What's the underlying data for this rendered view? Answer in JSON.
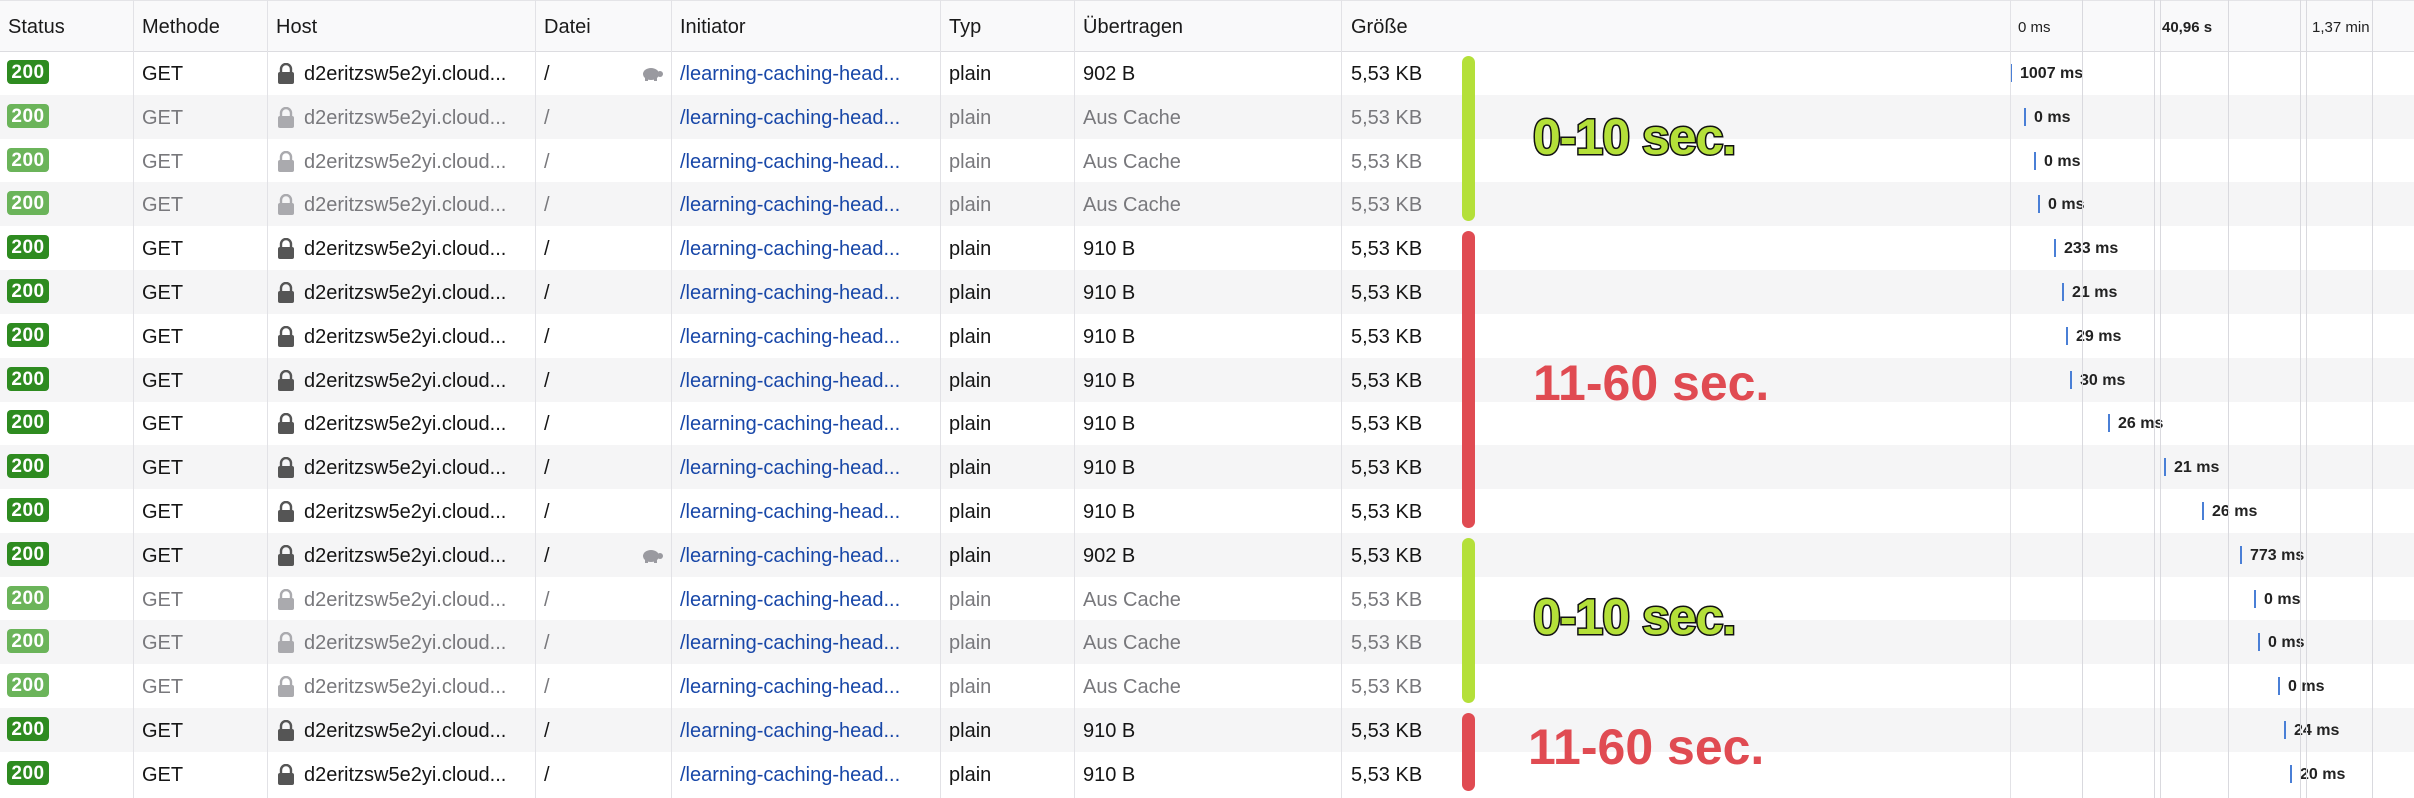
{
  "columns": {
    "status": "Status",
    "method": "Methode",
    "host": "Host",
    "file": "Datei",
    "initiator": "Initiator",
    "type": "Typ",
    "transferred": "Übertragen",
    "size": "Größe"
  },
  "timeline_ticks": [
    "0 ms",
    "40,96 s",
    "1,37 min"
  ],
  "rows": [
    {
      "status": "200",
      "method": "GET",
      "host": "d2eritzsw5e2yi.cloud...",
      "file": "/",
      "initiator": "/learning-caching-head...",
      "type": "plain",
      "transferred": "902 B",
      "size": "5,53 KB",
      "timing": "1007 ms",
      "cached": false,
      "slow": true
    },
    {
      "status": "200",
      "method": "GET",
      "host": "d2eritzsw5e2yi.cloud...",
      "file": "/",
      "initiator": "/learning-caching-head...",
      "type": "plain",
      "transferred": "Aus Cache",
      "size": "5,53 KB",
      "timing": "0 ms",
      "cached": true,
      "slow": false
    },
    {
      "status": "200",
      "method": "GET",
      "host": "d2eritzsw5e2yi.cloud...",
      "file": "/",
      "initiator": "/learning-caching-head...",
      "type": "plain",
      "transferred": "Aus Cache",
      "size": "5,53 KB",
      "timing": "0 ms",
      "cached": true,
      "slow": false
    },
    {
      "status": "200",
      "method": "GET",
      "host": "d2eritzsw5e2yi.cloud...",
      "file": "/",
      "initiator": "/learning-caching-head...",
      "type": "plain",
      "transferred": "Aus Cache",
      "size": "5,53 KB",
      "timing": "0 ms",
      "cached": true,
      "slow": false
    },
    {
      "status": "200",
      "method": "GET",
      "host": "d2eritzsw5e2yi.cloud...",
      "file": "/",
      "initiator": "/learning-caching-head...",
      "type": "plain",
      "transferred": "910 B",
      "size": "5,53 KB",
      "timing": "233 ms",
      "cached": false,
      "slow": false
    },
    {
      "status": "200",
      "method": "GET",
      "host": "d2eritzsw5e2yi.cloud...",
      "file": "/",
      "initiator": "/learning-caching-head...",
      "type": "plain",
      "transferred": "910 B",
      "size": "5,53 KB",
      "timing": "21 ms",
      "cached": false,
      "slow": false
    },
    {
      "status": "200",
      "method": "GET",
      "host": "d2eritzsw5e2yi.cloud...",
      "file": "/",
      "initiator": "/learning-caching-head...",
      "type": "plain",
      "transferred": "910 B",
      "size": "5,53 KB",
      "timing": "29 ms",
      "cached": false,
      "slow": false
    },
    {
      "status": "200",
      "method": "GET",
      "host": "d2eritzsw5e2yi.cloud...",
      "file": "/",
      "initiator": "/learning-caching-head...",
      "type": "plain",
      "transferred": "910 B",
      "size": "5,53 KB",
      "timing": "30 ms",
      "cached": false,
      "slow": false
    },
    {
      "status": "200",
      "method": "GET",
      "host": "d2eritzsw5e2yi.cloud...",
      "file": "/",
      "initiator": "/learning-caching-head...",
      "type": "plain",
      "transferred": "910 B",
      "size": "5,53 KB",
      "timing": "26 ms",
      "cached": false,
      "slow": false
    },
    {
      "status": "200",
      "method": "GET",
      "host": "d2eritzsw5e2yi.cloud...",
      "file": "/",
      "initiator": "/learning-caching-head...",
      "type": "plain",
      "transferred": "910 B",
      "size": "5,53 KB",
      "timing": "21 ms",
      "cached": false,
      "slow": false
    },
    {
      "status": "200",
      "method": "GET",
      "host": "d2eritzsw5e2yi.cloud...",
      "file": "/",
      "initiator": "/learning-caching-head...",
      "type": "plain",
      "transferred": "910 B",
      "size": "5,53 KB",
      "timing": "26 ms",
      "cached": false,
      "slow": false
    },
    {
      "status": "200",
      "method": "GET",
      "host": "d2eritzsw5e2yi.cloud...",
      "file": "/",
      "initiator": "/learning-caching-head...",
      "type": "plain",
      "transferred": "902 B",
      "size": "5,53 KB",
      "timing": "773 ms",
      "cached": false,
      "slow": true
    },
    {
      "status": "200",
      "method": "GET",
      "host": "d2eritzsw5e2yi.cloud...",
      "file": "/",
      "initiator": "/learning-caching-head...",
      "type": "plain",
      "transferred": "Aus Cache",
      "size": "5,53 KB",
      "timing": "0 ms",
      "cached": true,
      "slow": false
    },
    {
      "status": "200",
      "method": "GET",
      "host": "d2eritzsw5e2yi.cloud...",
      "file": "/",
      "initiator": "/learning-caching-head...",
      "type": "plain",
      "transferred": "Aus Cache",
      "size": "5,53 KB",
      "timing": "0 ms",
      "cached": true,
      "slow": false
    },
    {
      "status": "200",
      "method": "GET",
      "host": "d2eritzsw5e2yi.cloud...",
      "file": "/",
      "initiator": "/learning-caching-head...",
      "type": "plain",
      "transferred": "Aus Cache",
      "size": "5,53 KB",
      "timing": "0 ms",
      "cached": true,
      "slow": false
    },
    {
      "status": "200",
      "method": "GET",
      "host": "d2eritzsw5e2yi.cloud...",
      "file": "/",
      "initiator": "/learning-caching-head...",
      "type": "plain",
      "transferred": "910 B",
      "size": "5,53 KB",
      "timing": "24 ms",
      "cached": false,
      "slow": false
    },
    {
      "status": "200",
      "method": "GET",
      "host": "d2eritzsw5e2yi.cloud...",
      "file": "/",
      "initiator": "/learning-caching-head...",
      "type": "plain",
      "transferred": "910 B",
      "size": "5,53 KB",
      "timing": "20 ms",
      "cached": false,
      "slow": false
    }
  ],
  "annotations": [
    {
      "label": "0-10 sec.",
      "color": "#b4e039",
      "rows": [
        0,
        3
      ],
      "style": "green"
    },
    {
      "label": "11-60 sec.",
      "color": "#e04b52",
      "rows": [
        4,
        10
      ],
      "style": "red"
    },
    {
      "label": "0-10 sec.",
      "color": "#b4e039",
      "rows": [
        11,
        14
      ],
      "style": "green"
    },
    {
      "label": "11-60 sec.",
      "color": "#e04b52",
      "rows": [
        15,
        16
      ],
      "style": "red"
    }
  ],
  "colors": {
    "status_ok": "#2e8b20",
    "status_cached": "#6bb45a",
    "initiator_link": "#1847a8",
    "waterfall_bar": "#4a7fd6"
  }
}
